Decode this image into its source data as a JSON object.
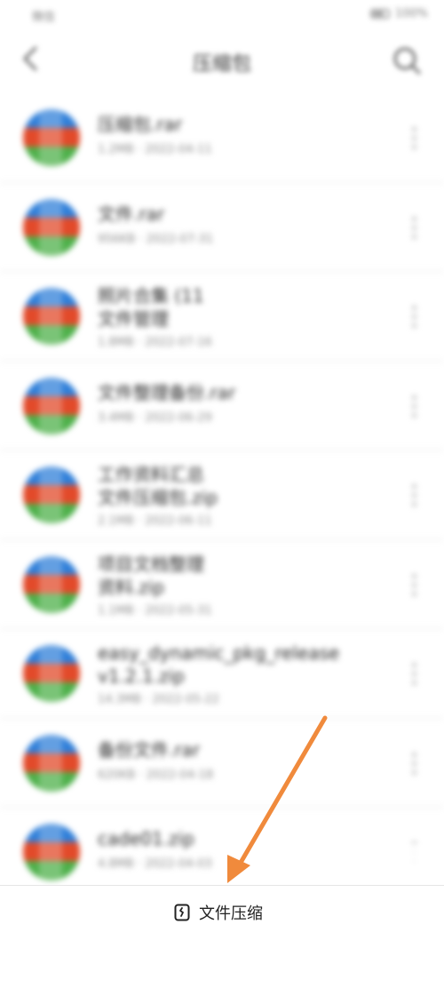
{
  "status_bar": {
    "left_text": "微信",
    "right_text": "100%"
  },
  "app_bar": {
    "title": "压缩包"
  },
  "files": [
    {
      "name": "压缩包.rar",
      "meta": "1.2MB · 2022-04-11",
      "two_line": false
    },
    {
      "name": "文件.rar",
      "meta": "956KB · 2022-07-31",
      "two_line": false
    },
    {
      "name": "照片合集 (11",
      "name2": "文件管理",
      "meta": "1.8MB · 2022-07-16",
      "two_line": true
    },
    {
      "name": "文件整理备份.rar",
      "meta": "3.4MB · 2022-06-29",
      "two_line": false
    },
    {
      "name": "工作资料汇总",
      "name2": "文件压缩包.zip",
      "meta": "2.1MB · 2022-06-11",
      "two_line": true
    },
    {
      "name": "项目文档整理",
      "name2": "资料.zip",
      "meta": "1.1MB · 2022-05-31",
      "two_line": true
    },
    {
      "name": "easy_dynamic_pkg_release",
      "name2": "v1.2.1.zip",
      "meta": "14.3MB · 2022-05-22",
      "two_line": true
    },
    {
      "name": "备份文件.rar",
      "meta": "620KB · 2022-04-18",
      "two_line": false
    },
    {
      "name": "cade01.zip",
      "meta": "4.8MB · 2022-04-03",
      "two_line": false
    }
  ],
  "bottom": {
    "compress_label": "文件压缩"
  },
  "colors": {
    "arrow": "#f08a3c",
    "text_primary": "#222222",
    "divider": "#e4e4e4"
  },
  "icons": {
    "back": "back-arrow-icon",
    "search": "search-icon",
    "more": "more-vertical-icon",
    "file": "archive-file-icon",
    "compress": "compress-icon"
  }
}
